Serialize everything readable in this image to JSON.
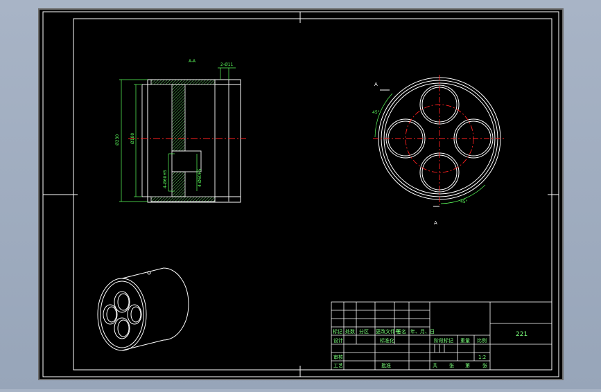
{
  "drawing": {
    "section_label": "A-A",
    "section_marker": "A",
    "angle_label": "45°",
    "dims": {
      "outer_diameter": "Ø230",
      "inner_diameter": "Ø180",
      "shoulder": "2-Ø11",
      "bore_left": "4-Ø60H5",
      "bore_right": "4-Ø60H5"
    }
  },
  "title_block": {
    "headers": [
      "标记",
      "处数",
      "分区",
      "更改文件号",
      "签名",
      "年、月、日"
    ],
    "row_design": "设计",
    "row_standard": "标准化",
    "row_review": "审核",
    "row_process": "工艺",
    "row_approve": "批准",
    "stage_label": "阶段标记",
    "weight_label": "重量",
    "scale_label": "比例",
    "scale_value": "1:2",
    "sheets_label_1": "共",
    "sheets_label_2": "张",
    "sheets_label_3": "第",
    "sheets_label_4": "张",
    "drawing_number": "221"
  },
  "colors": {
    "frame_background": "#000000",
    "line_white": "#ffffff",
    "dimension_green": "#5cff5c",
    "centerline_red": "#ff2020",
    "title_text_green": "#7cff7c"
  }
}
